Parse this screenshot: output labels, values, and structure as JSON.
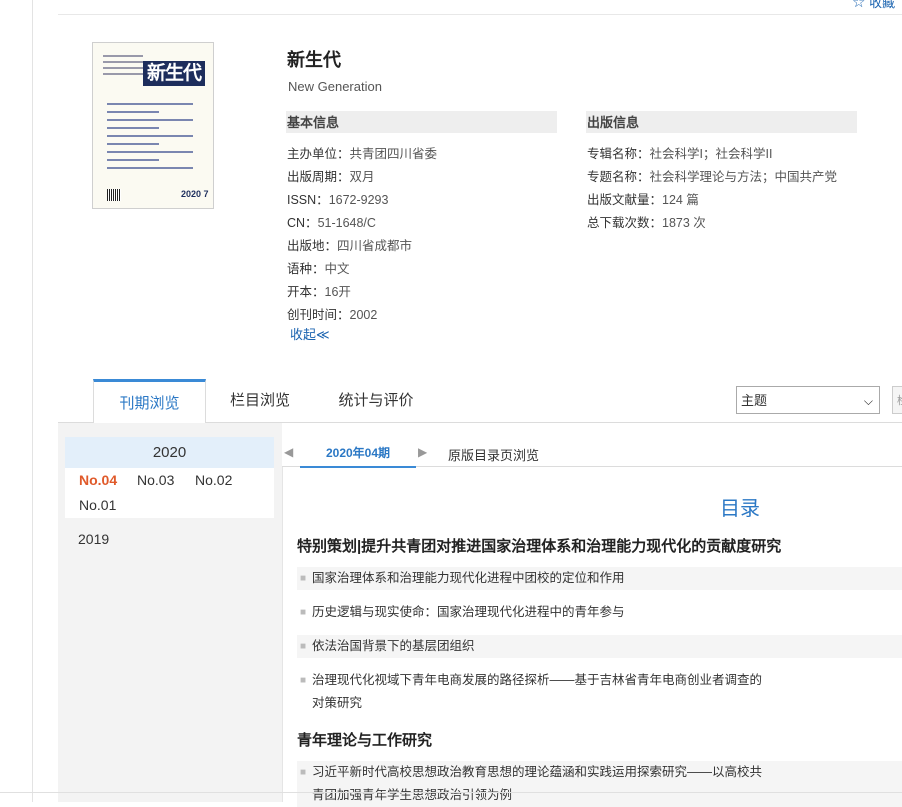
{
  "header": {
    "favorite_label": "收藏"
  },
  "journal": {
    "cover": {
      "title": "新生代",
      "issue_mark": "2020 7"
    },
    "title": "新生代",
    "subtitle": "New Generation",
    "collapse_label": "收起≪",
    "basic_info": {
      "heading": "基本信息",
      "rows": [
        {
          "label": "主办单位：",
          "value": "共青团四川省委"
        },
        {
          "label": "出版周期：",
          "value": "双月"
        },
        {
          "label": "ISSN：",
          "value": "1672-9293"
        },
        {
          "label": "CN：",
          "value": "51-1648/C"
        },
        {
          "label": "出版地：",
          "value": "四川省成都市"
        },
        {
          "label": "语种：",
          "value": "中文"
        },
        {
          "label": "开本：",
          "value": "16开"
        },
        {
          "label": "创刊时间：",
          "value": "2002"
        }
      ]
    },
    "publish_info": {
      "heading": "出版信息",
      "rows": [
        {
          "label": "专辑名称：",
          "value": "社会科学I；社会科学II"
        },
        {
          "label": "专题名称：",
          "value": "社会科学理论与方法；中国共产党"
        },
        {
          "label": "出版文献量：",
          "value": "124 篇"
        },
        {
          "label": "总下载次数：",
          "value": "1873 次"
        }
      ]
    }
  },
  "tabs": [
    {
      "label": "刊期浏览",
      "active": true
    },
    {
      "label": "栏目浏览",
      "active": false
    },
    {
      "label": "统计与评价",
      "active": false
    }
  ],
  "search": {
    "field_select": "主题",
    "button_stub": "检"
  },
  "years": {
    "active_year": "2020",
    "issues": [
      "No.04",
      "No.03",
      "No.02",
      "No.01"
    ],
    "current_issue": "No.04",
    "other_years": [
      "2019"
    ]
  },
  "issue_nav": {
    "prev_arrow": "◀",
    "next_arrow": "▶",
    "current_issue": "2020年04期",
    "toc_view_label": "原版目录页浏览"
  },
  "toc": {
    "heading": "目录",
    "sections": [
      {
        "title": "特别策划|提升共青团对推进国家治理体系和治理能力现代化的贡献度研究",
        "articles": [
          "国家治理体系和治理能力现代化进程中团校的定位和作用",
          "历史逻辑与现实使命：国家治理现代化进程中的青年参与",
          "依法治国背景下的基层团组织",
          "治理现代化视域下青年电商发展的路径探析——基于吉林省青年电商创业者调查的对策研究"
        ]
      },
      {
        "title": "青年理论与工作研究",
        "articles": [
          "习近平新时代高校思想政治教育思想的理论蕴涵和实践运用探索研究——以高校共青团加强青年学生思想政治引领为例"
        ]
      }
    ]
  },
  "colors": {
    "accent": "#2b78c5",
    "current_issue": "#e05a2a",
    "tab_border": "#3a8ad6"
  }
}
